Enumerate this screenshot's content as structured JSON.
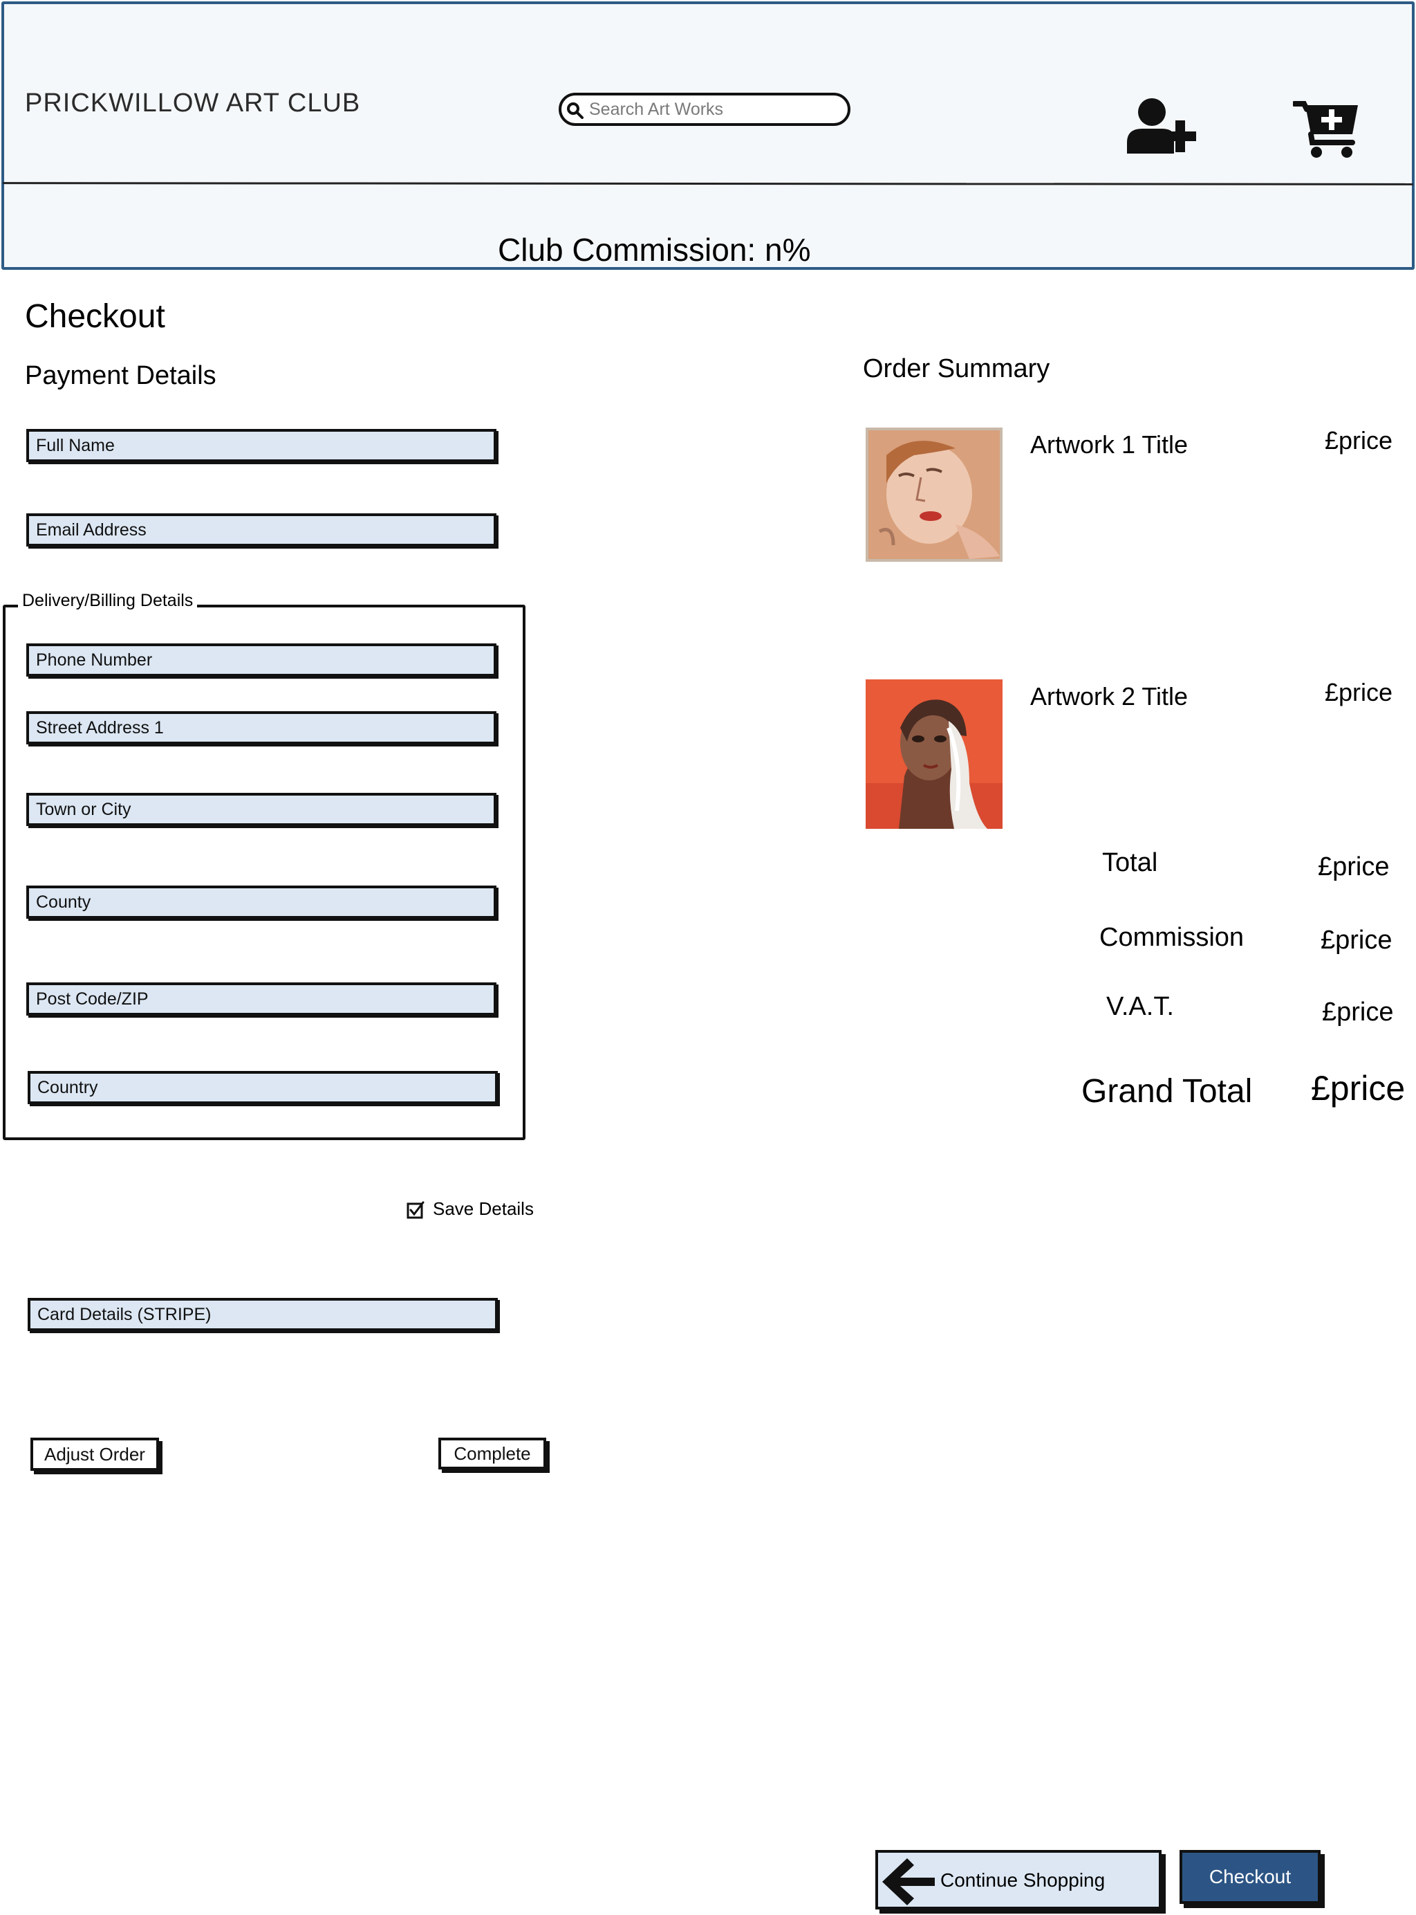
{
  "header": {
    "brand": "PRICKWILLOW ART CLUB",
    "search": {
      "placeholder": "Search Art Works"
    },
    "commission_text": "Club Commission: n%",
    "icons": [
      "search-icon",
      "add-user-icon",
      "add-to-cart-icon"
    ]
  },
  "page": {
    "title": "Checkout",
    "payment_title": "Payment Details",
    "summary_title": "Order Summary"
  },
  "form": {
    "full_name": "Full Name",
    "email": "Email Address",
    "billing_legend": "Delivery/Billing Details",
    "phone": "Phone Number",
    "street1": "Street Address 1",
    "town": "Town or City",
    "county": "County",
    "postcode": "Post Code/ZIP",
    "country": "Country",
    "save_details": {
      "label": "Save Details",
      "checked": true
    },
    "card_details": "Card Details (STRIPE)",
    "adjust_order": "Adjust Order",
    "complete": "Complete"
  },
  "order": {
    "items": [
      {
        "title": "Artwork 1 Title",
        "price": "£price"
      },
      {
        "title": "Artwork 2 Title",
        "price": "£price"
      }
    ],
    "total": {
      "label": "Total",
      "value": "£price"
    },
    "commission": {
      "label": "Commission",
      "value": "£price"
    },
    "vat": {
      "label": "V.A.T.",
      "value": "£price"
    },
    "grand_total": {
      "label": "Grand Total",
      "value": "£price"
    }
  },
  "footer": {
    "continue_shopping": "Continue Shopping",
    "checkout": "Checkout"
  },
  "colors": {
    "header_bg": "#f5f8fb",
    "header_border": "#2f5b86",
    "field_bg": "#dce7f3",
    "checkout_button": "#2c5585"
  }
}
